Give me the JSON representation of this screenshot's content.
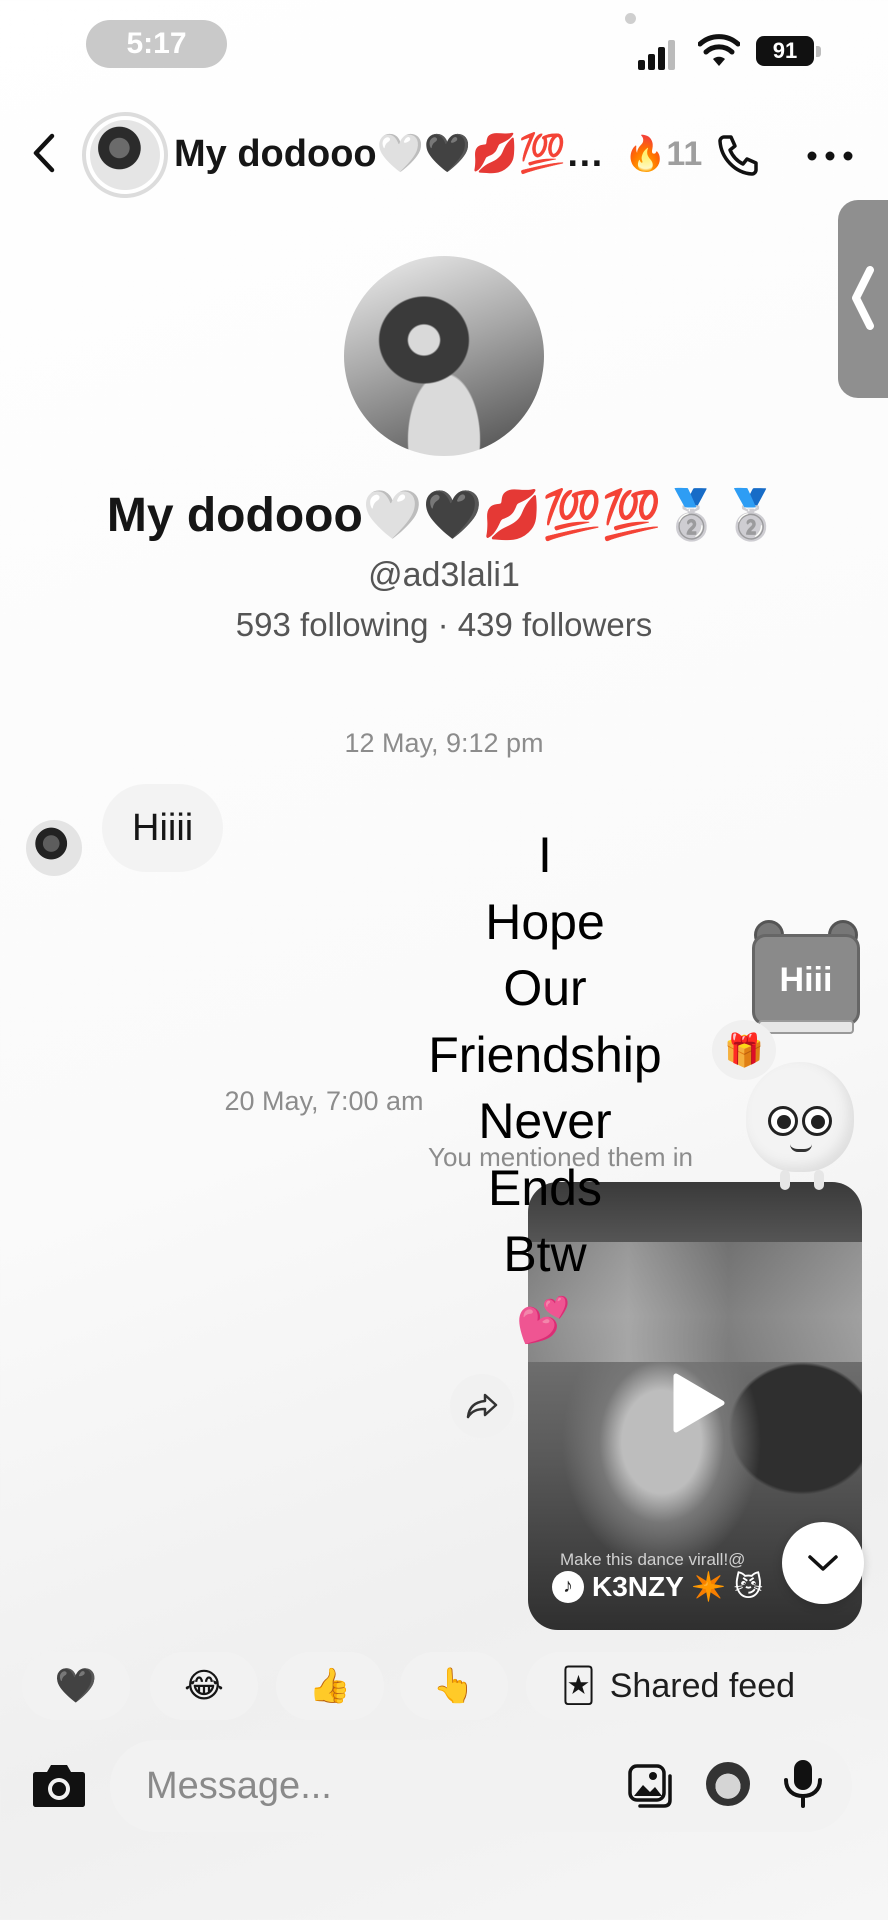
{
  "status_bar": {
    "time": "5:17",
    "battery": "91"
  },
  "header": {
    "name": "My dodooo🤍🖤💋💯…",
    "streak": "🔥11",
    "icons": [
      "back-icon",
      "avatar",
      "call-icon",
      "more-icon",
      "side-handle"
    ]
  },
  "profile": {
    "name": "My dodooo🤍🖤💋💯💯🥈🥈",
    "handle": "@ad3lali1",
    "stats": "593 following · 439 followers"
  },
  "messages": {
    "timestamp_1": "12 May, 9:12 pm",
    "incoming_text": "Hiiii",
    "timestamp_2": "20 May, 7:00 am",
    "mention_note": "You mentioned them in",
    "video": {
      "caption": "Make this dance virall!@",
      "author": "K3NZY ✴️ 😼"
    }
  },
  "overlay": {
    "lines": [
      "I",
      "Hope",
      "Our",
      "Friendship",
      "Never",
      "Ends",
      "Btw"
    ],
    "hearts": "💕"
  },
  "sticker": {
    "calendar_text": "Hiii",
    "gift": "🎁"
  },
  "quick_replies": {
    "chips": [
      {
        "emoji": "🖤"
      },
      {
        "emoji": "😂"
      },
      {
        "emoji": "👍"
      },
      {
        "emoji": "👆"
      },
      {
        "emoji": "🃏",
        "label": "Shared feed"
      }
    ]
  },
  "composer": {
    "placeholder": "Message..."
  }
}
